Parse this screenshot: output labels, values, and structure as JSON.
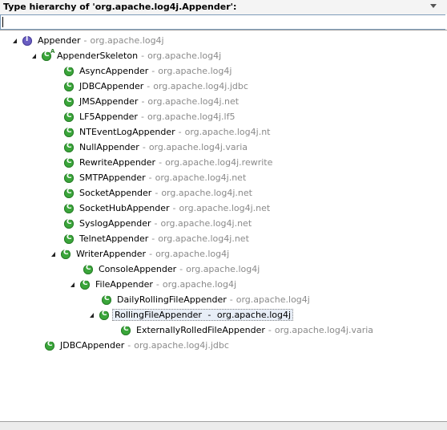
{
  "header": {
    "title": "Type hierarchy of 'org.apache.log4j.Appender':"
  },
  "filter": {
    "value": ""
  },
  "tree": {
    "items": [
      {
        "name": "Appender",
        "package": "org.apache.log4j",
        "kind": "interface",
        "expanded": true
      },
      {
        "name": "AppenderSkeleton",
        "package": "org.apache.log4j",
        "kind": "abstract-class",
        "expanded": true
      },
      {
        "name": "AsyncAppender",
        "package": "org.apache.log4j",
        "kind": "class"
      },
      {
        "name": "JDBCAppender",
        "package": "org.apache.log4j.jdbc",
        "kind": "class"
      },
      {
        "name": "JMSAppender",
        "package": "org.apache.log4j.net",
        "kind": "class"
      },
      {
        "name": "LF5Appender",
        "package": "org.apache.log4j.lf5",
        "kind": "class"
      },
      {
        "name": "NTEventLogAppender",
        "package": "org.apache.log4j.nt",
        "kind": "class"
      },
      {
        "name": "NullAppender",
        "package": "org.apache.log4j.varia",
        "kind": "class"
      },
      {
        "name": "RewriteAppender",
        "package": "org.apache.log4j.rewrite",
        "kind": "class"
      },
      {
        "name": "SMTPAppender",
        "package": "org.apache.log4j.net",
        "kind": "class"
      },
      {
        "name": "SocketAppender",
        "package": "org.apache.log4j.net",
        "kind": "class"
      },
      {
        "name": "SocketHubAppender",
        "package": "org.apache.log4j.net",
        "kind": "class"
      },
      {
        "name": "SyslogAppender",
        "package": "org.apache.log4j.net",
        "kind": "class"
      },
      {
        "name": "TelnetAppender",
        "package": "org.apache.log4j.net",
        "kind": "class"
      },
      {
        "name": "WriterAppender",
        "package": "org.apache.log4j",
        "kind": "class",
        "expanded": true
      },
      {
        "name": "ConsoleAppender",
        "package": "org.apache.log4j",
        "kind": "class"
      },
      {
        "name": "FileAppender",
        "package": "org.apache.log4j",
        "kind": "class",
        "expanded": true
      },
      {
        "name": "DailyRollingFileAppender",
        "package": "org.apache.log4j",
        "kind": "class"
      },
      {
        "name": "RollingFileAppender",
        "package": "org.apache.log4j",
        "kind": "class",
        "expanded": true,
        "selected": true
      },
      {
        "name": "ExternallyRolledFileAppender",
        "package": "org.apache.log4j.varia",
        "kind": "class"
      },
      {
        "name": "JDBCAppender",
        "package": "org.apache.log4j.jdbc",
        "kind": "class"
      }
    ],
    "separator": "-"
  },
  "icons": {
    "expanded_toggle": "triangle-down-right-icon",
    "class": "class-icon",
    "interface": "interface-icon"
  },
  "colors": {
    "class_icon": "#3aa63a",
    "interface_icon": "#6a5ec2",
    "package_text": "#8a8a8a"
  }
}
